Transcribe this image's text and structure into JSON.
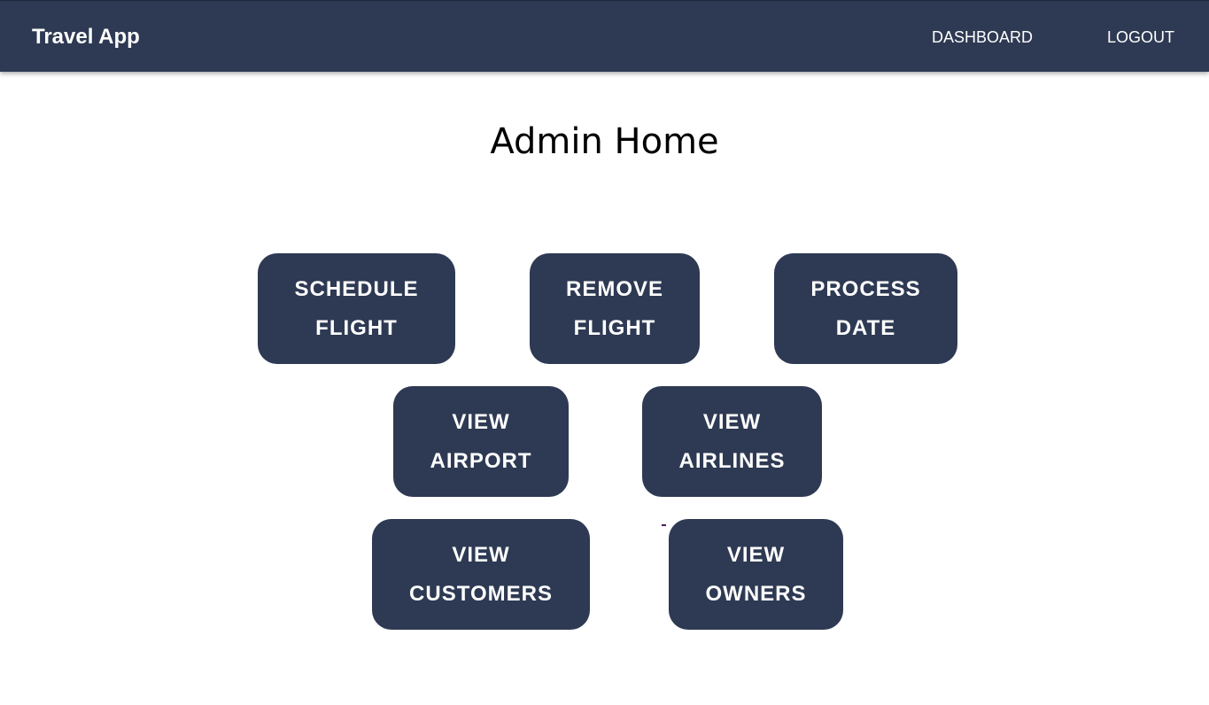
{
  "navbar": {
    "brand": "Travel App",
    "links": {
      "dashboard": "DASHBOARD",
      "logout": "LOGOUT"
    }
  },
  "main": {
    "title": "Admin Home",
    "tiles": {
      "schedule_flight": {
        "line1": "SCHEDULE",
        "line2": "FLIGHT"
      },
      "remove_flight": {
        "line1": "REMOVE",
        "line2": "FLIGHT"
      },
      "process_date": {
        "line1": "PROCESS",
        "line2": "DATE"
      },
      "view_airport": {
        "line1": "VIEW",
        "line2": "AIRPORT"
      },
      "view_airlines": {
        "line1": "VIEW",
        "line2": "AIRLINES"
      },
      "view_customers": {
        "line1": "VIEW",
        "line2": "CUSTOMERS"
      },
      "view_owners": {
        "line1": "VIEW",
        "line2": "OWNERS"
      }
    }
  },
  "colors": {
    "navbar_bg": "#2e3a53",
    "tile_bg": "#2e3a53",
    "tile_text": "#ffffff",
    "page_bg": "#ffffff"
  }
}
